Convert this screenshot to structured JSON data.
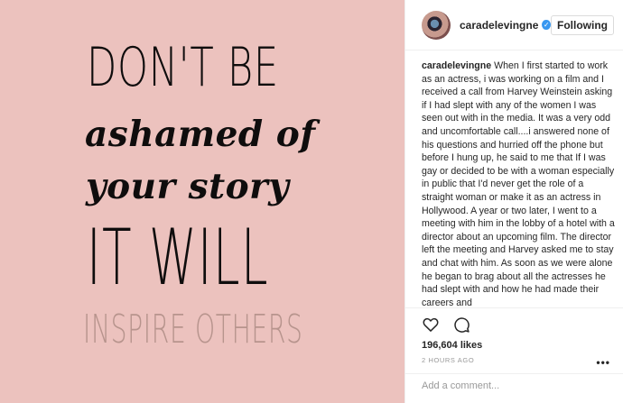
{
  "image": {
    "background": "#ecc2be",
    "lines": [
      "DON'T BE",
      "ashamed of",
      "your story",
      "IT WILL",
      "INSPIRE OTHERS"
    ]
  },
  "header": {
    "username": "caradelevingne",
    "follow_label": "Following"
  },
  "caption": {
    "username": "caradelevingne",
    "text": "When I first started to work as an actress, i was working on a film and I received a call from Harvey Weinstein asking if I had slept with any of the women I was seen out with in the media. It was a very odd and uncomfortable call....i answered none of his questions and hurried off the phone but before I hung up, he said to me that If I was gay or decided to be with a woman especially in public that I'd never get the role of a straight woman or make it as an actress in Hollywood. A year or two later, I went to a meeting with him in the lobby of a hotel with a director about an upcoming film. The director left the meeting and Harvey asked me to stay and chat with him. As soon as we were alone he began to brag about all the actresses he had slept with and how he had made their careers and"
  },
  "stats": {
    "likes": "196,604 likes",
    "time": "2 HOURS AGO",
    "more": "•••"
  },
  "comment": {
    "placeholder": "Add a comment..."
  },
  "icons": {
    "like": "heart-icon",
    "comment": "comment-icon",
    "verified": "verified-badge-icon",
    "more": "more-options-icon"
  },
  "colors": {
    "accent": "#3897f0",
    "image_bg": "#ecc2be"
  }
}
